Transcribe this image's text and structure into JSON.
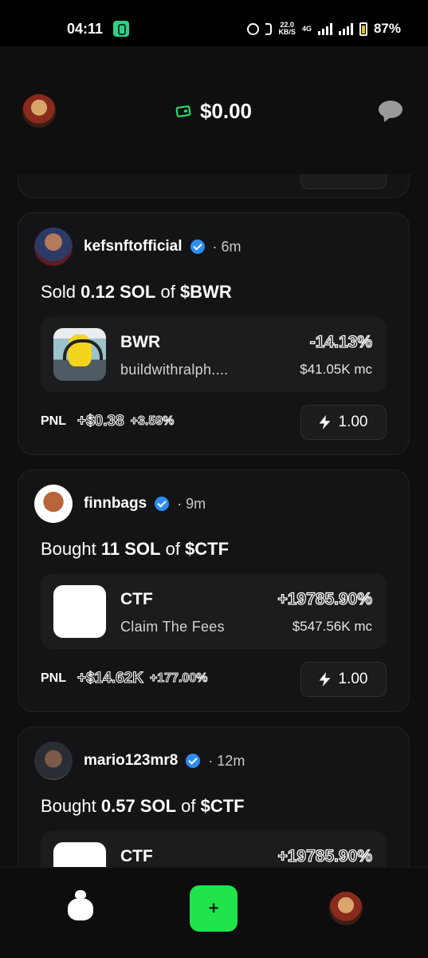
{
  "status_bar": {
    "time": "04:11",
    "speed_top": "22.0",
    "speed_unit": "KB/S",
    "network": "4G",
    "battery": "87%"
  },
  "header": {
    "balance": "$0.00",
    "accent_color": "#2ee56b"
  },
  "feed": [
    {
      "user": "kefsnftofficial",
      "time": "· 6m",
      "verified": true,
      "action": "Sold",
      "amount": "0.12 SOL",
      "of": "of",
      "ticker": "$BWR",
      "token_symbol": "BWR",
      "token_name": "buildwithralph....",
      "change": "-14.13%",
      "market_cap": "$41.05K mc",
      "pnl_label": "PNL",
      "pnl_usd": "+$0.38",
      "pnl_pct": "+3.59%",
      "quick_buy": "1.00"
    },
    {
      "user": "finnbags",
      "time": "· 9m",
      "verified": true,
      "action": "Bought",
      "amount": "11 SOL",
      "of": "of",
      "ticker": "$CTF",
      "token_symbol": "CTF",
      "token_name": "Claim The Fees",
      "change": "+19785.90%",
      "market_cap": "$547.56K mc",
      "pnl_label": "PNL",
      "pnl_usd": "+$14.62K",
      "pnl_pct": "+177.00%",
      "quick_buy": "1.00"
    },
    {
      "user": "mario123mr8",
      "time": "· 12m",
      "verified": true,
      "action": "Bought",
      "amount": "0.57 SOL",
      "of": "of",
      "ticker": "$CTF",
      "token_symbol": "CTF",
      "change": "+19785.90%"
    }
  ],
  "bottom_nav": {
    "plus_label": "+",
    "icons": [
      "bag-icon",
      "plus-icon",
      "profile-avatar"
    ],
    "plus_color": "#21e34c"
  }
}
